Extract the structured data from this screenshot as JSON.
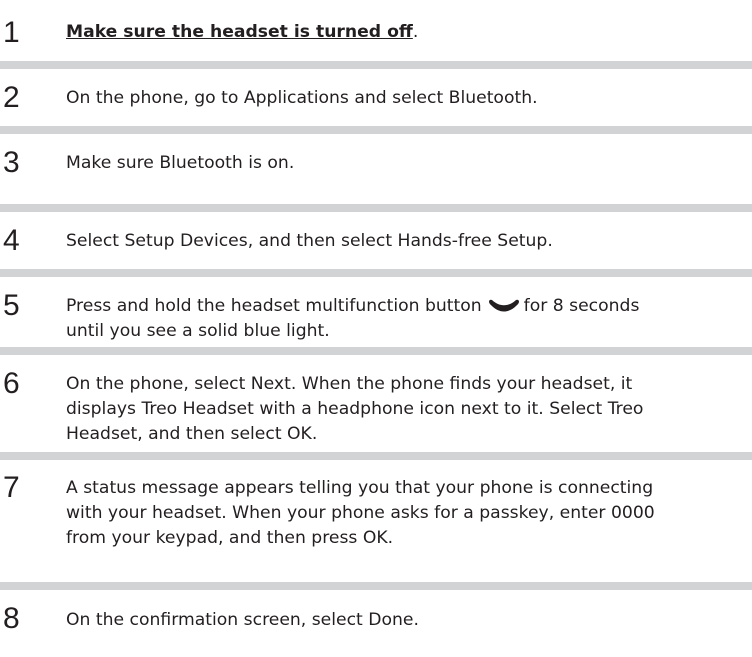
{
  "steps": [
    {
      "number": "1",
      "link_text": "Make sure the headset is turned off",
      "after_link": "."
    },
    {
      "number": "2",
      "lines": [
        "On the phone, go to Applications and select Bluetooth."
      ]
    },
    {
      "number": "3",
      "lines": [
        "Make sure Bluetooth is on."
      ]
    },
    {
      "number": "4",
      "lines": [
        "Select Setup Devices, and then select Hands-free Setup."
      ]
    },
    {
      "number": "5",
      "line1_before_icon": "Press and hold the headset multifunction button",
      "line1_after_icon": "for 8 seconds",
      "line2": "until you see a solid blue light.",
      "icon": "phone-handset-icon"
    },
    {
      "number": "6",
      "lines": [
        "On the phone, select Next. When the phone finds your headset, it",
        "displays Treo Headset with a headphone icon next to it. Select Treo",
        "Headset, and then select OK."
      ]
    },
    {
      "number": "7",
      "lines": [
        "A status message appears telling you that your phone is connecting",
        "with your headset. When your phone asks for a passkey, enter 0000",
        "from your keypad, and then press OK."
      ]
    },
    {
      "number": "8",
      "lines": [
        "On the confirmation screen, select Done."
      ]
    }
  ]
}
